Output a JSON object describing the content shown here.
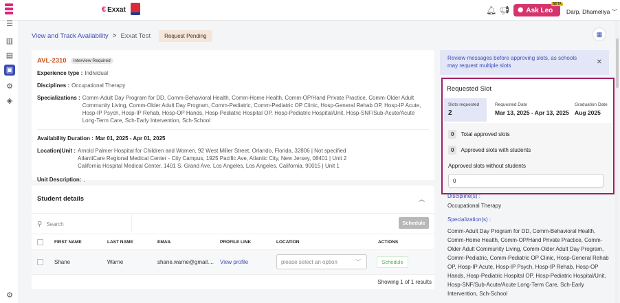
{
  "topbar": {
    "brand": "Exxat",
    "ask_leo": "Ask Leo",
    "beta": "BETA",
    "user": "Darp, Dhameliya"
  },
  "breadcrumb": {
    "link": "View and Track Availability",
    "current": "Exxat Test",
    "status": "Request Pending"
  },
  "info": {
    "id": "AVL-2310",
    "tag": "Interview Required",
    "experience_label": "Experience type :",
    "experience": "Individual",
    "disciplines_label": "Disciplines :",
    "disciplines": "Occupational Therapy",
    "specializations_label": "Specializations :",
    "specializations": "Comm-Adult Day Program for DD, Comm-Behavioral Health, Comm-Home Health, Comm-OP/Hand Private Practice, Comm-Older Adult Community Living, Comm-Older Adult Day Program, Comm-Pediatric, Comm-Pediatric OP Clinic, Hosp-General Rehab OP, Hosp-IP Acute, Hosp-IP Psych, Hosp-IP Rehab, Hosp-OP Hands, Hosp-Pediatric Hospital OP, Hosp-Pediatric Hospital/Unit, Hosp-SNF/Sub-Acute/Acute Long-Term Care, Sch-Early Intervention, Sch-School",
    "duration_label": "Availability Duration :",
    "duration": "Mar 01, 2025 - Apr 01, 2025",
    "location_label": "Location|Unit :",
    "location_1": "Arnold Palmer Hospital for Children and Women, 92 West Miller Street, Orlando, Florida, 32806 | Not specified",
    "location_2": "AtlantiCare Regional Medical Center - City Campus, 1925 Pacific Ave, Atlantic City, New Jersey, 08401 | Unit 2",
    "location_3": "California Hospital Medical Center, 1401 S. Grand Ave. Los Angeles, Los Angeles, California, 90015 | Unit 1",
    "unit_desc_label": "Unit Description:",
    "unit_desc": ","
  },
  "students": {
    "title": "Student details",
    "search_placeholder": "Search",
    "schedule": "Schedule",
    "columns": [
      "FIRST NAME",
      "LAST NAME",
      "EMAIL",
      "PROFILE LINK",
      "LOCATION",
      "ACTIONS"
    ],
    "rows": [
      {
        "first": "Shane",
        "last": "Warne",
        "email": "shane.warne@gmail....",
        "profile": "View profile",
        "location": "please select an option",
        "action": "Schedule"
      }
    ],
    "showing": "Showing 1 of 1 results"
  },
  "notice": "Review messages before approving slots, as schools may request multiple slots",
  "requested": {
    "title": "Requested Slot",
    "slots_label": "Slots requested",
    "slots": "2",
    "date_label": "Requested Date",
    "date": "Mar 13, 2025 - Apr 13, 2025",
    "grad_label": "Graduation Date",
    "grad": "Aug 2025",
    "total_count": "0",
    "total_label": "Total approved slots",
    "with_count": "0",
    "with_label": "Approved slots with students",
    "without_label": "Approved slots without students",
    "without_value": "0"
  },
  "right": {
    "disc_head": "Discipline(s) :",
    "disc": "Occupational Therapy",
    "spec_head": "Specialization(s) :",
    "spec_lines": [
      "Comm-Adult Day Program for DD, Comm-Behavioral Health,",
      "Comm-Home Health, Comm-OP/Hand Private Practice, Comm-",
      "Older Adult Community Living, Comm-Older Adult Day Program,",
      "Comm-Pediatric, Comm-Pediatric OP Clinic, Hosp-General Rehab",
      "OP, Hosp-IP Acute, Hosp-IP Psych, Hosp-IP Rehab, Hosp-OP",
      "Hands, Hosp-Pediatric Hospital OP, Hosp-Pediatric Hospital/Unit,",
      "Hosp-SNF/Sub-Acute/Acute Long-Term Care, Sch-Early",
      "Intervention, Sch-School"
    ]
  }
}
